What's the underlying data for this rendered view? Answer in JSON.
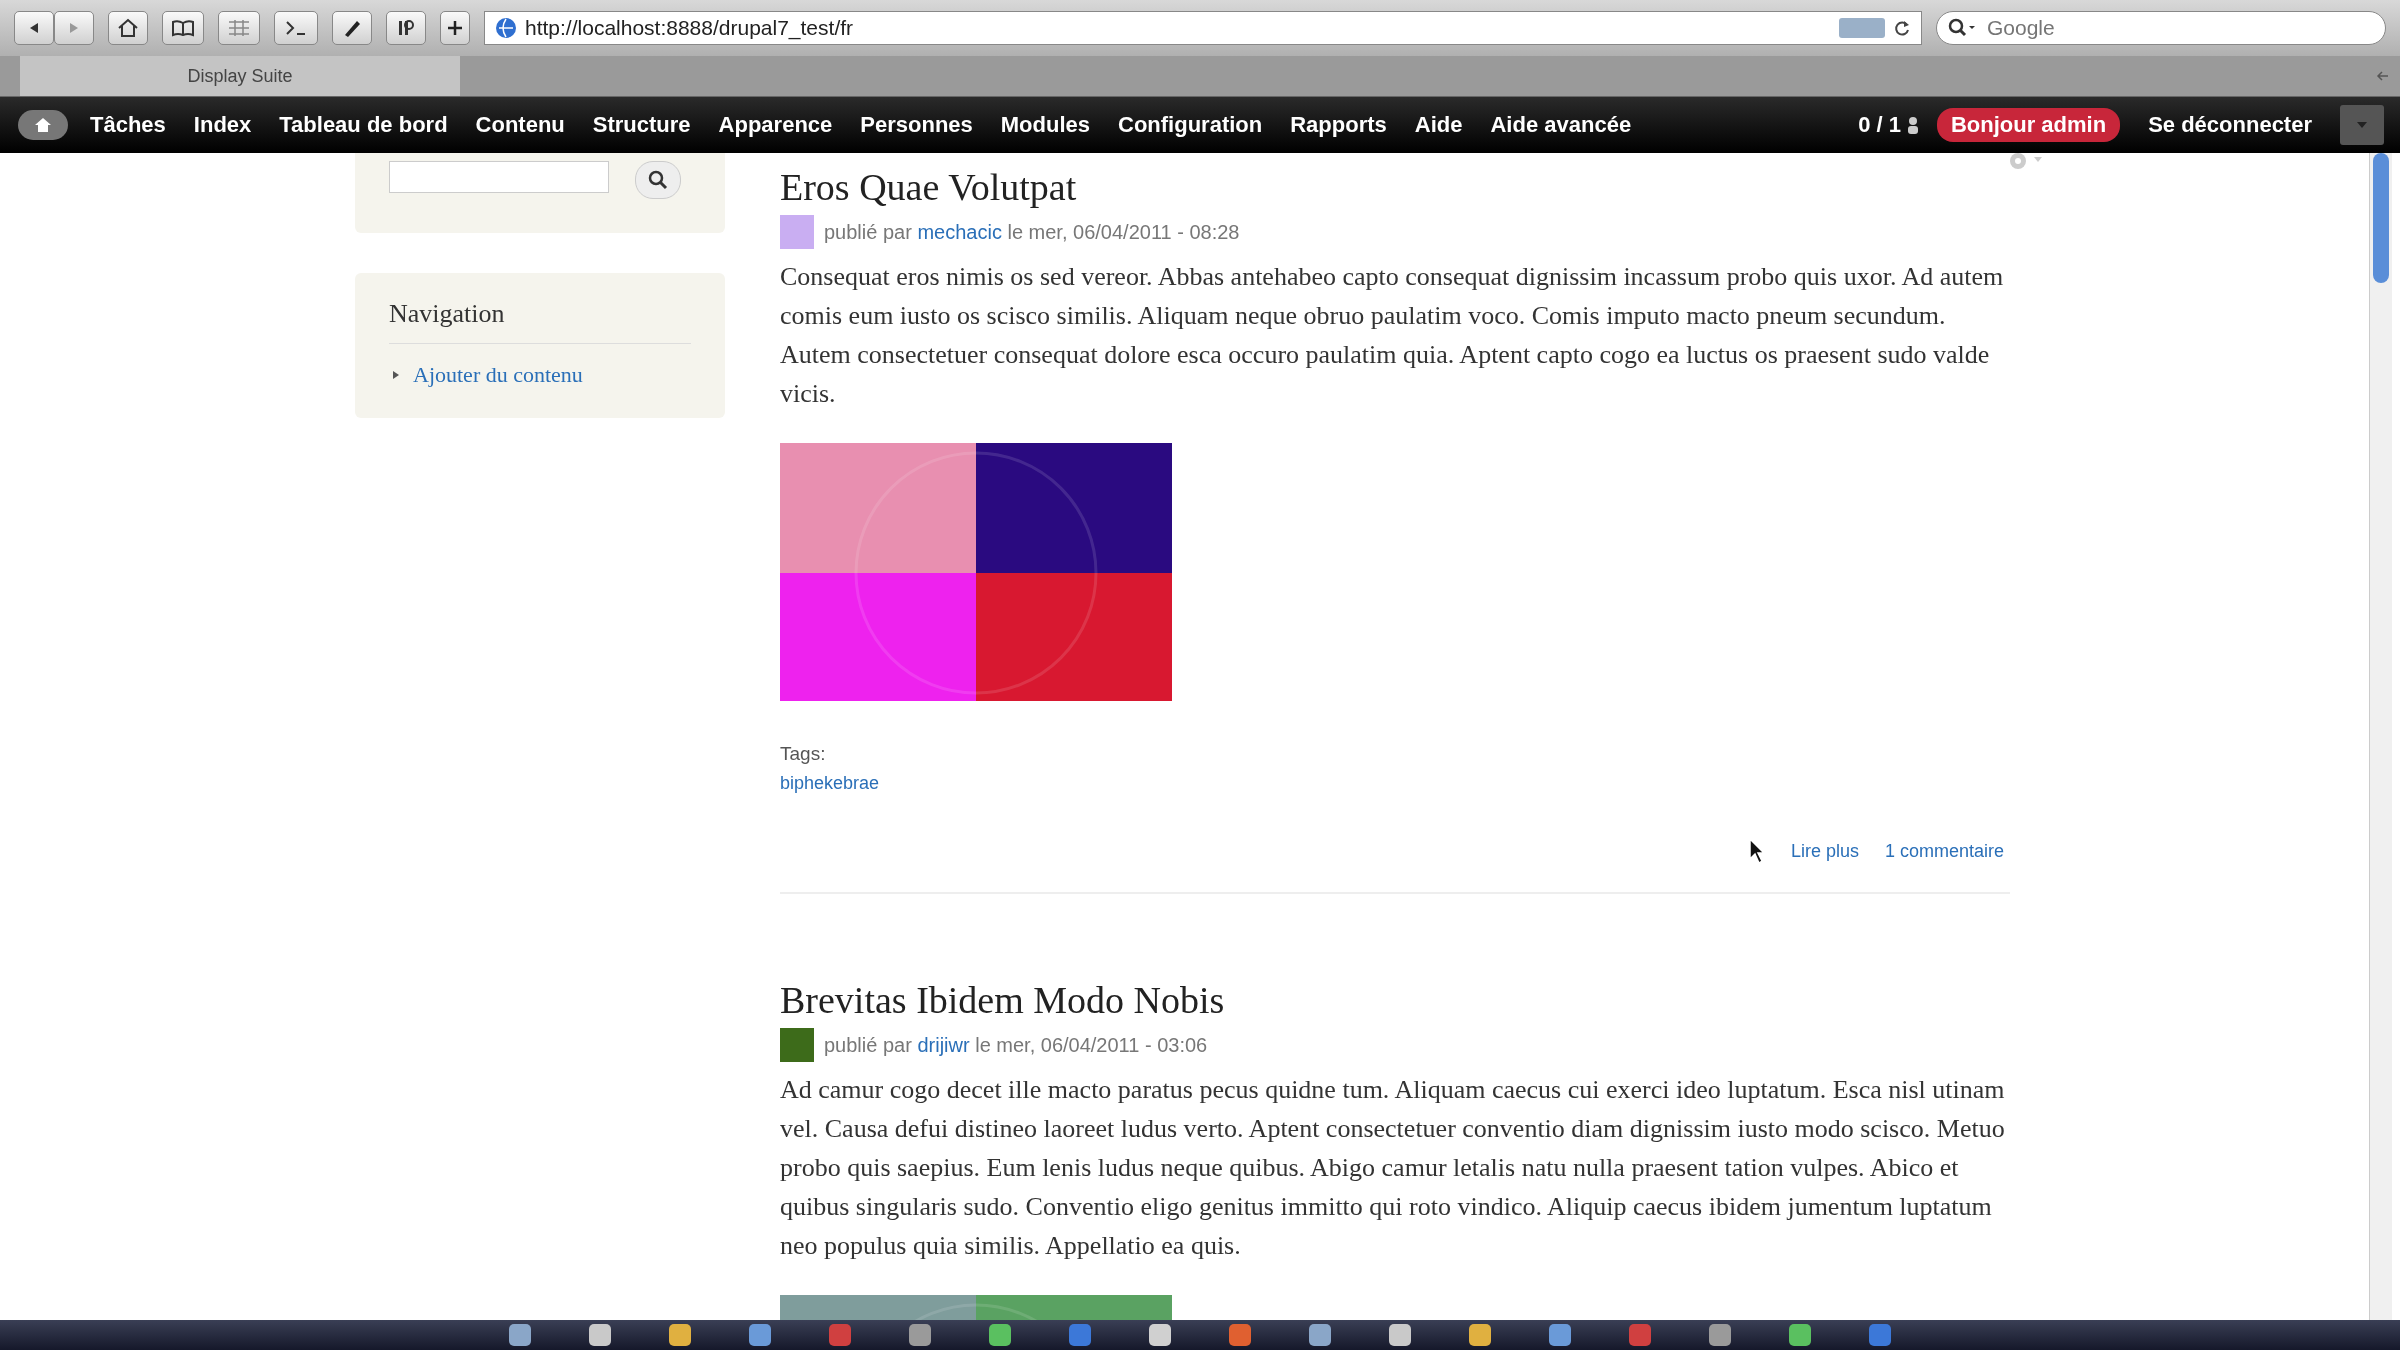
{
  "browser": {
    "url": "http://localhost:8888/drupal7_test/fr",
    "search": {
      "placeholder": "Google"
    },
    "tabs": [
      {
        "label": "Display Suite",
        "selected": true
      }
    ]
  },
  "admin_menu": {
    "items": [
      "Tâches",
      "Index",
      "Tableau de bord",
      "Contenu",
      "Structure",
      "Apparence",
      "Personnes",
      "Modules",
      "Configuration",
      "Rapports",
      "Aide",
      "Aide avancée"
    ],
    "user_count": "0 / 1",
    "greeting": "Bonjour admin",
    "logout": "Se déconnecter"
  },
  "sidebar": {
    "navigation": {
      "title": "Navigation",
      "items": [
        "Ajouter du contenu"
      ]
    }
  },
  "articles": [
    {
      "title": "Eros Quae Volutpat",
      "color": "#c9aef2",
      "meta_prefix": "publié par",
      "author": "mechacic",
      "meta_date": "le mer, 06/04/2011 - 08:28",
      "body": "Consequat eros nimis os sed vereor. Abbas antehabeo capto consequat dignissim incassum probo quis uxor. Ad autem comis eum iusto os scisco similis. Aliquam neque obruo paulatim voco. Comis imputo macto pneum secundum. Autem consectetuer consequat dolore esca occuro paulatim quia. Aptent capto cogo ea luctus os praesent sudo valde vicis.",
      "image": {
        "kind": "picture"
      },
      "tags_label": "Tags:",
      "tags": [
        "biphekebrae"
      ],
      "links": [
        "Lire plus",
        "1 commentaire"
      ]
    },
    {
      "title": "Brevitas Ibidem Modo Nobis",
      "color": "#3d6b1a",
      "meta_prefix": "publié par",
      "author": "drijiwr",
      "meta_date": "le mer, 06/04/2011 - 03:06",
      "body": "Ad camur cogo decet ille macto paratus pecus quidne tum. Aliquam caecus cui exerci ideo luptatum. Esca nisl utinam vel. Causa defui distineo laoreet ludus verto. Aptent consectetuer conventio diam dignissim iusto modo scisco. Metuo probo quis saepius. Eum lenis ludus neque quibus. Abigo camur letalis natu nulla praesent tation vulpes. Abico et quibus singularis sudo. Conventio eligo genitus immitto qui roto vindico. Aliquip caecus ibidem jumentum luptatum neo populus quia similis. Appellatio ea quis.",
      "image": {
        "kind": "picture"
      }
    }
  ]
}
